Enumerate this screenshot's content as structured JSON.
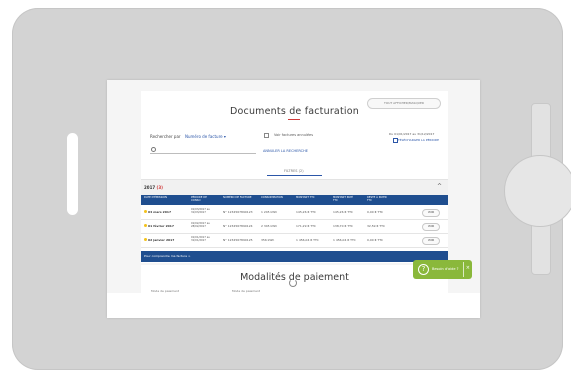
{
  "header": {
    "title": "Documents de facturation",
    "right_button": "TOUT AFFICHER/MASQUER"
  },
  "search": {
    "label": "Rechercher par",
    "select_value": "Numéro de facture ▾",
    "placeholder": ""
  },
  "filters": {
    "checkbox_label": "Voir factures annulées",
    "cancel_link": "ANNULER LA RECHERCHE",
    "date_text": "Du 01/01/2017 au 31/12/2017",
    "download_link": "TÉLÉCHARGER LA PÉRIODE",
    "filter_tab": "FILTRES (2)"
  },
  "section": {
    "title": "2017",
    "count": "(3)",
    "chevron": "^"
  },
  "table": {
    "headers": [
      "DATE D'ÉMISSION",
      "PÉRIODE DE CONSO",
      "NUMÉRO DE FACTURE",
      "CONSOMMATION",
      "MONTANT TTC",
      "MONTANT PAYÉ TTC",
      "RESTE À PAYER TTC"
    ],
    "rows": [
      {
        "date": "04 mars 2017",
        "period": "01/03/2017 au 31/03/2017",
        "number": "N° 1234567890123",
        "conso": "1 245 kWh",
        "amount": "145,26 € TTC",
        "paid": "145,26 € TTC",
        "rest": "0,00 € TTC",
        "action": "VOIR"
      },
      {
        "date": "01 février 2017",
        "period": "01/02/2017 au 28/02/2017",
        "number": "N° 1234567890124",
        "conso": "2 345 kWh",
        "amount": "171,29 € TTC",
        "paid": "138,70 € TTC",
        "rest": "32,59 € TTC",
        "action": "VOIR"
      },
      {
        "date": "02 janvier 2017",
        "period": "01/01/2017 au 31/01/2017",
        "number": "N° 1234567890125",
        "conso": "356 kWh",
        "amount": "1 456,04 € TTC",
        "paid": "1 456,04 € TTC",
        "rest": "0,00 € TTC",
        "action": "VOIR"
      }
    ],
    "footer": "Pour comprendre ma facture >"
  },
  "payment": {
    "title": "Modalités de paiement",
    "sub1": "Mode de paiement",
    "sub2": "Mode de paiement"
  },
  "help": {
    "icon": "?",
    "label": "Besoin d'aide ?",
    "close": "×"
  },
  "colors": {
    "accent": "#1f4e8f",
    "link": "#2b56a8",
    "alert": "#d03a3a",
    "help": "#8ab83b",
    "status": "#f4c21b",
    "device": "#d3d3d3"
  }
}
